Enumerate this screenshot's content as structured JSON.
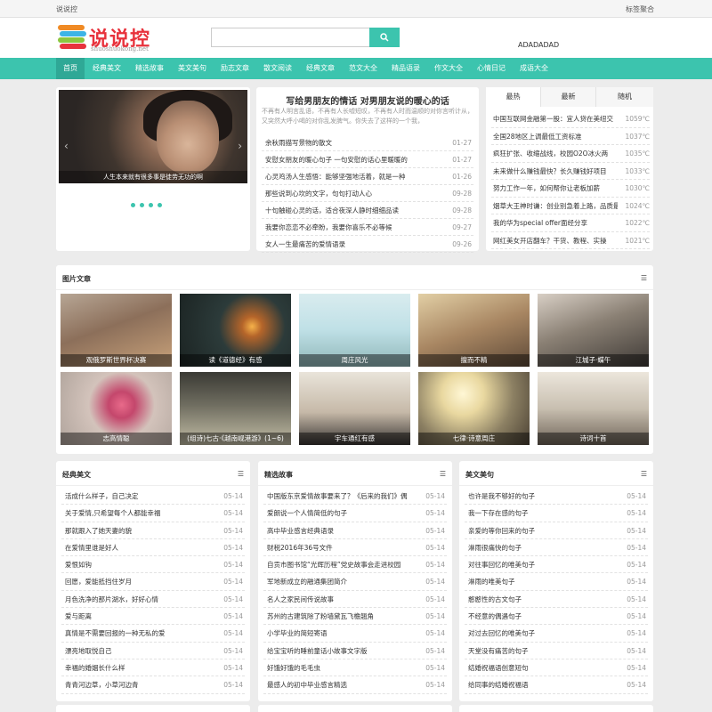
{
  "topbar": {
    "site": "说说控",
    "right_link": "标签聚合"
  },
  "logo": {
    "text": "说说控",
    "sub": "shuoshuokong.net"
  },
  "search": {
    "placeholder": ""
  },
  "ad": "ADADADAD",
  "nav": [
    "首页",
    "经典美文",
    "精选故事",
    "美文美句",
    "励志文章",
    "散文阅读",
    "经典文章",
    "范文大全",
    "精品语录",
    "作文大全",
    "心情日记",
    "成语大全"
  ],
  "slider": {
    "caption": "人生本来就有很多事是徒劳无功的啊",
    "dots": 4
  },
  "feature": {
    "title": "写给男朋友的情话 对男朋友说的暖心的话",
    "desc": "不再有人明言乱语，不再有人长嘘短叹，不再有人时而温顺的对你言听计从，又突然大呼小喝的对你乱发脾气。你失去了这样的一个我，",
    "items": [
      {
        "t": "余秋雨描写景物的散文",
        "d": "01-27"
      },
      {
        "t": "安慰女朋友的暖心句子 一句安慰的话心里暖暖的",
        "d": "01-27"
      },
      {
        "t": "心灵鸡汤人生感悟：能够坚强地活着，就是一种",
        "d": "01-26"
      },
      {
        "t": "那些说到心坎的文字，句句打动人心",
        "d": "09-28"
      },
      {
        "t": "十句触碰心灵的话，适合夜深人静时细细品读",
        "d": "09-28"
      },
      {
        "t": "我要你恋恋不必牵盼，我要你喜乐不必等候",
        "d": "09-27"
      },
      {
        "t": "女人一生最痛苦的爱情语录",
        "d": "09-26"
      }
    ]
  },
  "hot": {
    "tabs": [
      "最热",
      "最新",
      "随机"
    ],
    "items": [
      {
        "t": "中国互联网金融第一股：宜人贷在美纽交",
        "d": "1059℃"
      },
      {
        "t": "全国28地区上调最低工资标准",
        "d": "1037℃"
      },
      {
        "t": "疯狂扩张、收缩战线，校园O2O冰火两",
        "d": "1035℃"
      },
      {
        "t": "未来做什么赚钱最快？长久赚钱好项目",
        "d": "1033℃"
      },
      {
        "t": "努力工作一年，如何帮你让老板加薪",
        "d": "1030℃"
      },
      {
        "t": "烟草大王神时谦：创业别急着上路，品质最重",
        "d": "1024℃"
      },
      {
        "t": "我的华为special offer面经分享",
        "d": "1022℃"
      },
      {
        "t": "网红美女开店翻车？干货、教程、实操",
        "d": "1021℃"
      }
    ]
  },
  "pics": {
    "title": "图片文章",
    "items": [
      "观俄罗斯世界杯决赛",
      "读《道德经》有感",
      "周庄风光",
      "擅而不精",
      "江城子·蝶午",
      "志高情聪",
      "(组诗)七古·《越南岘港游》(1~6)",
      "宇车通红有感",
      "七律·诗意周庄",
      "诗词十首"
    ]
  },
  "columns": [
    {
      "title": "经典美文",
      "items": [
        {
          "t": "活成什么样子，自己决定",
          "d": "05-14"
        },
        {
          "t": "关于爱情,只希望每个人都能幸福",
          "d": "05-14"
        },
        {
          "t": "那就跟入了她天妻的貌",
          "d": "05-14"
        },
        {
          "t": "在爱情里谁是好人",
          "d": "05-14"
        },
        {
          "t": "爱恨如钩",
          "d": "05-14"
        },
        {
          "t": "回愿，爱能抵挡住岁月",
          "d": "05-14"
        },
        {
          "t": "月色洗净的那片湖水，好好心情",
          "d": "05-14"
        },
        {
          "t": "爱与距离",
          "d": "05-14"
        },
        {
          "t": "真情是不需要回报的一种无私的爱",
          "d": "05-14"
        },
        {
          "t": "漂亮地取悦自己",
          "d": "05-14"
        },
        {
          "t": "幸福的婚姻长什么样",
          "d": "05-14"
        },
        {
          "t": "青青河边草，小草河边青",
          "d": "05-14"
        }
      ]
    },
    {
      "title": "精选故事",
      "items": [
        {
          "t": "中国版东京爱情故事要来了？《后来的我们》偶",
          "d": "05-14"
        },
        {
          "t": "爱朗说一个人情简低的句子",
          "d": "05-14"
        },
        {
          "t": "高中毕业感言经典语录",
          "d": "05-14"
        },
        {
          "t": "财税2016年36号文件",
          "d": "05-14"
        },
        {
          "t": "自贡市图书馆“光辉历程”党史故事会走进校园",
          "d": "05-14"
        },
        {
          "t": "军地新成立的融通集团简介",
          "d": "05-14"
        },
        {
          "t": "名人之家民间传说故事",
          "d": "05-14"
        },
        {
          "t": "苏州的古建筑除了粉墙黛瓦飞檐翘角",
          "d": "05-14"
        },
        {
          "t": "小学毕业的简短寄语",
          "d": "05-14"
        },
        {
          "t": "给宝宝听的睡前童话小故事文字版",
          "d": "05-14"
        },
        {
          "t": "好饿好饿的毛毛虫",
          "d": "05-14"
        },
        {
          "t": "最感人的初中毕业感言精选",
          "d": "05-14"
        }
      ]
    },
    {
      "title": "美文美句",
      "items": [
        {
          "t": "也许是我不够好的句子",
          "d": "05-14"
        },
        {
          "t": "我一下存在感的句子",
          "d": "05-14"
        },
        {
          "t": "亲爱的等你回来的句子",
          "d": "05-14"
        },
        {
          "t": "淋雨很痛快的句子",
          "d": "05-14"
        },
        {
          "t": "对往事回忆的唯美句子",
          "d": "05-14"
        },
        {
          "t": "淋雨的唯美句子",
          "d": "05-14"
        },
        {
          "t": "憨憨性的古文句子",
          "d": "05-14"
        },
        {
          "t": "不经意的偶遇句子",
          "d": "05-14"
        },
        {
          "t": "对过去回忆的唯美句子",
          "d": "05-14"
        },
        {
          "t": "天堂没有痛苦的句子",
          "d": "05-14"
        },
        {
          "t": "结婚祝福语创意短句",
          "d": "05-14"
        },
        {
          "t": "给同事的结婚祝福语",
          "d": "05-14"
        }
      ]
    }
  ]
}
